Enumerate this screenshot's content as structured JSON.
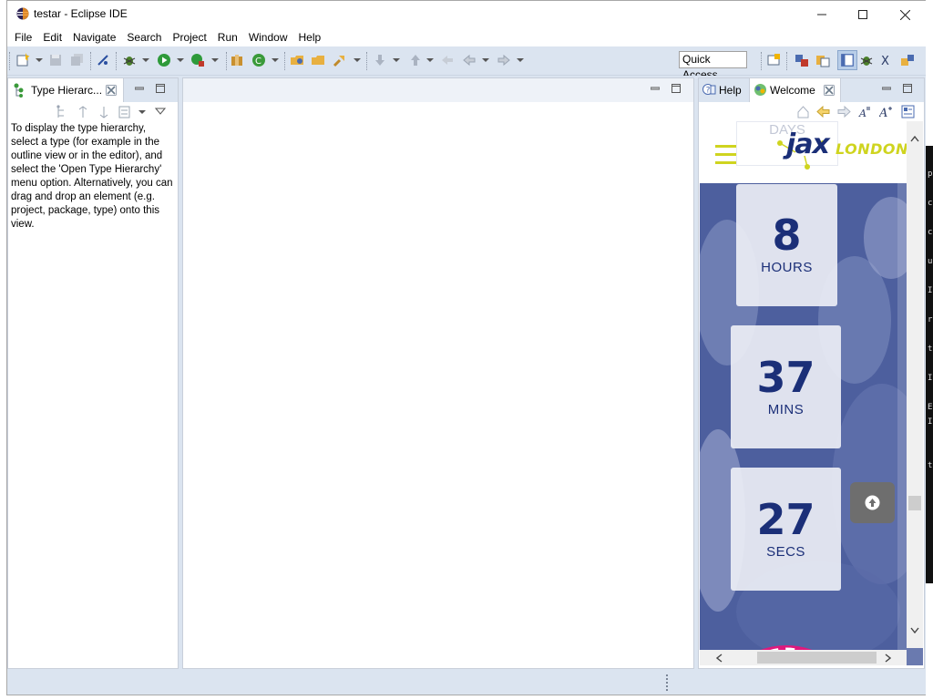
{
  "window": {
    "title": "testar - Eclipse IDE"
  },
  "menubar": {
    "items": [
      "File",
      "Edit",
      "Navigate",
      "Search",
      "Project",
      "Run",
      "Window",
      "Help"
    ]
  },
  "toolbar": {
    "quick_access": "Quick Access"
  },
  "type_hierarchy": {
    "tab_label": "Type Hierarc...",
    "message": "To display the type hierarchy, select a type (for example in the outline view or in the editor), and select the 'Open Type Hierarchy' menu option. Alternatively, you can drag and drop an element (e.g. project, package, type) onto this view."
  },
  "right_panel": {
    "tabs": [
      "Help",
      "Welcome"
    ],
    "active_tab": "Welcome"
  },
  "welcome": {
    "logo_text_main": "jax",
    "logo_text_secondary": "LONDON",
    "days_label": "DAYS",
    "countdown": [
      {
        "value": "8",
        "unit": "HOURS"
      },
      {
        "value": "37",
        "unit": "MINS"
      },
      {
        "value": "27",
        "unit": "SECS"
      }
    ]
  },
  "desktop_edge_chars": [
    "p",
    "c",
    "c",
    "u",
    "I",
    "r",
    "t",
    "I",
    "E",
    "I",
    "t"
  ],
  "colors": {
    "toolbar_bg": "#dbe4f0",
    "welcome_overlay": "#3b4e8f",
    "countdown_text": "#1b2f78",
    "logo_yellow": "#cfd41f",
    "scroll_top_button": "#6e6e6e",
    "accent_magenta": "#e0197d"
  }
}
